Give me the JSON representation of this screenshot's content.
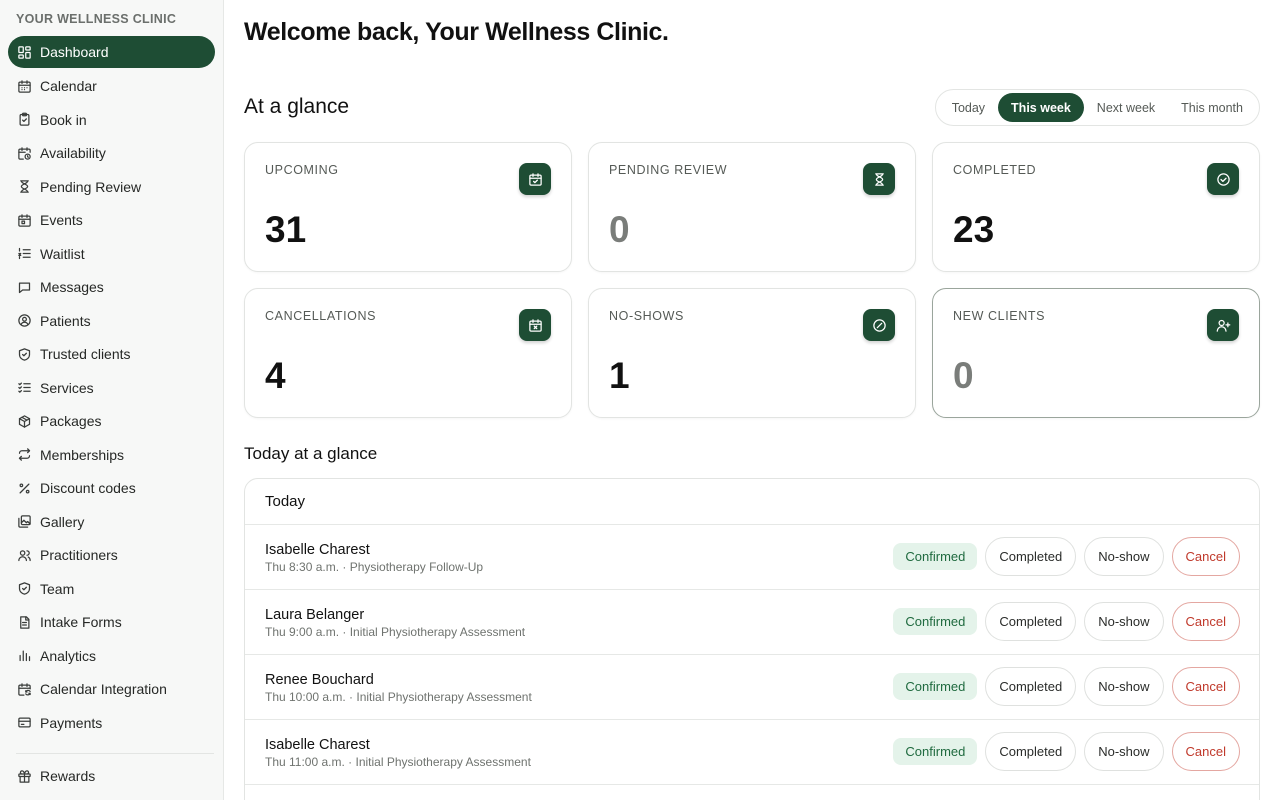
{
  "brand": "YOUR WELLNESS CLINIC",
  "nav": [
    {
      "label": "Dashboard",
      "icon": "dashboard-icon",
      "active": true
    },
    {
      "label": "Calendar",
      "icon": "calendar-icon"
    },
    {
      "label": "Book in",
      "icon": "clipboard-icon"
    },
    {
      "label": "Availability",
      "icon": "calendar-clock-icon"
    },
    {
      "label": "Pending Review",
      "icon": "hourglass-icon"
    },
    {
      "label": "Events",
      "icon": "calendar-event-icon"
    },
    {
      "label": "Waitlist",
      "icon": "list-ordered-icon"
    },
    {
      "label": "Messages",
      "icon": "message-icon"
    },
    {
      "label": "Patients",
      "icon": "user-circle-icon"
    },
    {
      "label": "Trusted clients",
      "icon": "shield-check-icon"
    },
    {
      "label": "Services",
      "icon": "list-check-icon"
    },
    {
      "label": "Packages",
      "icon": "package-icon"
    },
    {
      "label": "Memberships",
      "icon": "repeat-icon"
    },
    {
      "label": "Discount codes",
      "icon": "percent-icon"
    },
    {
      "label": "Gallery",
      "icon": "gallery-icon"
    },
    {
      "label": "Practitioners",
      "icon": "users-icon"
    },
    {
      "label": "Team",
      "icon": "shield-icon"
    },
    {
      "label": "Intake Forms",
      "icon": "document-icon"
    },
    {
      "label": "Analytics",
      "icon": "bar-chart-icon"
    },
    {
      "label": "Calendar Integration",
      "icon": "calendar-sync-icon"
    },
    {
      "label": "Payments",
      "icon": "credit-card-icon"
    }
  ],
  "nav_bottom": [
    {
      "label": "Rewards",
      "icon": "gift-icon"
    }
  ],
  "welcome": "Welcome back, Your Wellness Clinic.",
  "at_a_glance": "At a glance",
  "range_options": [
    {
      "label": "Today",
      "selected": false
    },
    {
      "label": "This week",
      "selected": true
    },
    {
      "label": "Next week",
      "selected": false
    },
    {
      "label": "This month",
      "selected": false
    }
  ],
  "cards": [
    {
      "title": "UPCOMING",
      "value": "31",
      "icon": "calendar-check-icon",
      "zero": false
    },
    {
      "title": "PENDING REVIEW",
      "value": "0",
      "icon": "hourglass-icon",
      "zero": true
    },
    {
      "title": "COMPLETED",
      "value": "23",
      "icon": "check-circle-icon",
      "zero": false
    },
    {
      "title": "CANCELLATIONS",
      "value": "4",
      "icon": "calendar-x-icon",
      "zero": false
    },
    {
      "title": "NO-SHOWS",
      "value": "1",
      "icon": "ban-icon",
      "zero": false
    },
    {
      "title": "NEW CLIENTS",
      "value": "0",
      "icon": "user-plus-icon",
      "zero": true,
      "highlighted": true
    }
  ],
  "today_title": "Today at a glance",
  "today_panel": {
    "heading": "Today",
    "status_label": "Confirmed",
    "completed_label": "Completed",
    "noshow_label": "No-show",
    "cancel_label": "Cancel",
    "appointments": [
      {
        "name": "Isabelle Charest",
        "meta": "Thu 8:30 a.m. · Physiotherapy Follow-Up"
      },
      {
        "name": "Laura Belanger",
        "meta": "Thu 9:00 a.m. · Initial Physiotherapy Assessment"
      },
      {
        "name": "Renee Bouchard",
        "meta": "Thu 10:00 a.m. · Initial Physiotherapy Assessment"
      },
      {
        "name": "Isabelle Charest",
        "meta": "Thu 11:00 a.m. · Initial Physiotherapy Assessment"
      }
    ]
  },
  "colors": {
    "accent": "#1e4d34",
    "confirmed_bg": "#e4f3ea",
    "confirmed_text": "#1f6a3f",
    "cancel": "#c0392b"
  }
}
